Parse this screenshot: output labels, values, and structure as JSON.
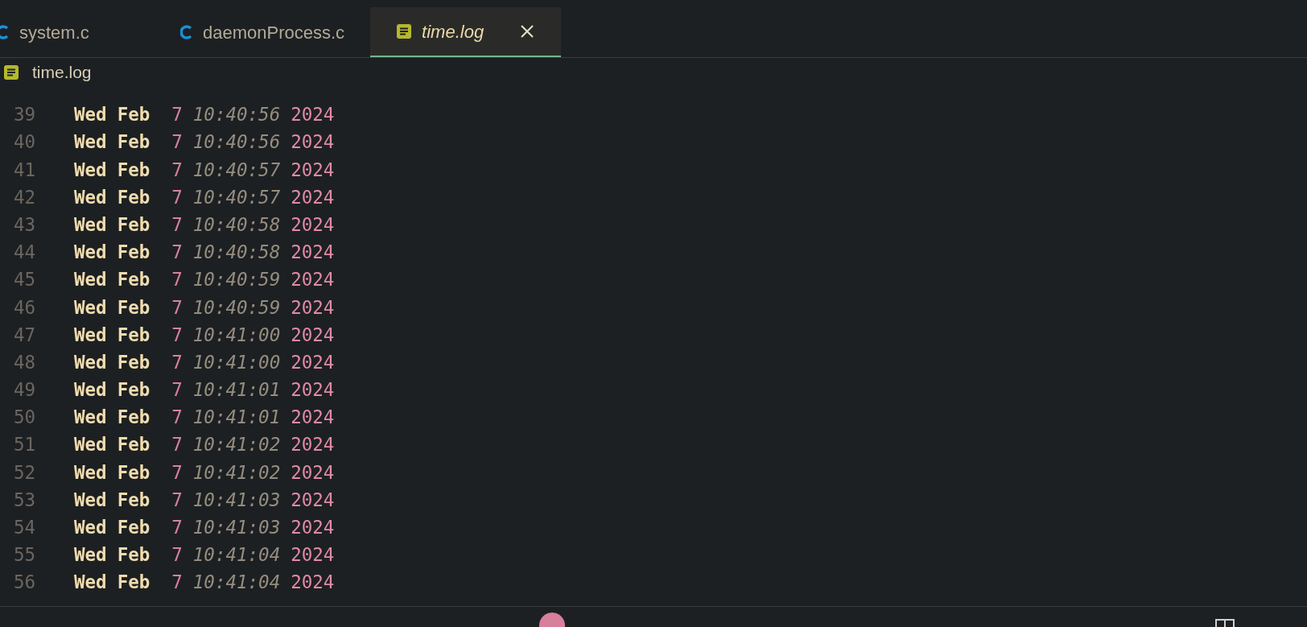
{
  "tabs": [
    {
      "label": "system.c",
      "kind": "c",
      "selected": false,
      "italic": false
    },
    {
      "label": "daemonProcess.c",
      "kind": "c",
      "selected": false,
      "italic": false
    },
    {
      "label": "time.log",
      "kind": "log",
      "selected": true,
      "italic": true
    }
  ],
  "breadcrumb": {
    "label": "time.log",
    "kind": "log"
  },
  "lines": [
    {
      "number": "39",
      "weekday": "Wed",
      "month": "Feb",
      "day": "7",
      "time": "10:40:56",
      "year": "2024"
    },
    {
      "number": "40",
      "weekday": "Wed",
      "month": "Feb",
      "day": "7",
      "time": "10:40:56",
      "year": "2024"
    },
    {
      "number": "41",
      "weekday": "Wed",
      "month": "Feb",
      "day": "7",
      "time": "10:40:57",
      "year": "2024"
    },
    {
      "number": "42",
      "weekday": "Wed",
      "month": "Feb",
      "day": "7",
      "time": "10:40:57",
      "year": "2024"
    },
    {
      "number": "43",
      "weekday": "Wed",
      "month": "Feb",
      "day": "7",
      "time": "10:40:58",
      "year": "2024"
    },
    {
      "number": "44",
      "weekday": "Wed",
      "month": "Feb",
      "day": "7",
      "time": "10:40:58",
      "year": "2024"
    },
    {
      "number": "45",
      "weekday": "Wed",
      "month": "Feb",
      "day": "7",
      "time": "10:40:59",
      "year": "2024"
    },
    {
      "number": "46",
      "weekday": "Wed",
      "month": "Feb",
      "day": "7",
      "time": "10:40:59",
      "year": "2024"
    },
    {
      "number": "47",
      "weekday": "Wed",
      "month": "Feb",
      "day": "7",
      "time": "10:41:00",
      "year": "2024"
    },
    {
      "number": "48",
      "weekday": "Wed",
      "month": "Feb",
      "day": "7",
      "time": "10:41:00",
      "year": "2024"
    },
    {
      "number": "49",
      "weekday": "Wed",
      "month": "Feb",
      "day": "7",
      "time": "10:41:01",
      "year": "2024"
    },
    {
      "number": "50",
      "weekday": "Wed",
      "month": "Feb",
      "day": "7",
      "time": "10:41:01",
      "year": "2024"
    },
    {
      "number": "51",
      "weekday": "Wed",
      "month": "Feb",
      "day": "7",
      "time": "10:41:02",
      "year": "2024"
    },
    {
      "number": "52",
      "weekday": "Wed",
      "month": "Feb",
      "day": "7",
      "time": "10:41:02",
      "year": "2024"
    },
    {
      "number": "53",
      "weekday": "Wed",
      "month": "Feb",
      "day": "7",
      "time": "10:41:03",
      "year": "2024"
    },
    {
      "number": "54",
      "weekday": "Wed",
      "month": "Feb",
      "day": "7",
      "time": "10:41:03",
      "year": "2024"
    },
    {
      "number": "55",
      "weekday": "Wed",
      "month": "Feb",
      "day": "7",
      "time": "10:41:04",
      "year": "2024"
    },
    {
      "number": "56",
      "weekday": "Wed",
      "month": "Feb",
      "day": "7",
      "time": "10:41:04",
      "year": "2024"
    }
  ]
}
